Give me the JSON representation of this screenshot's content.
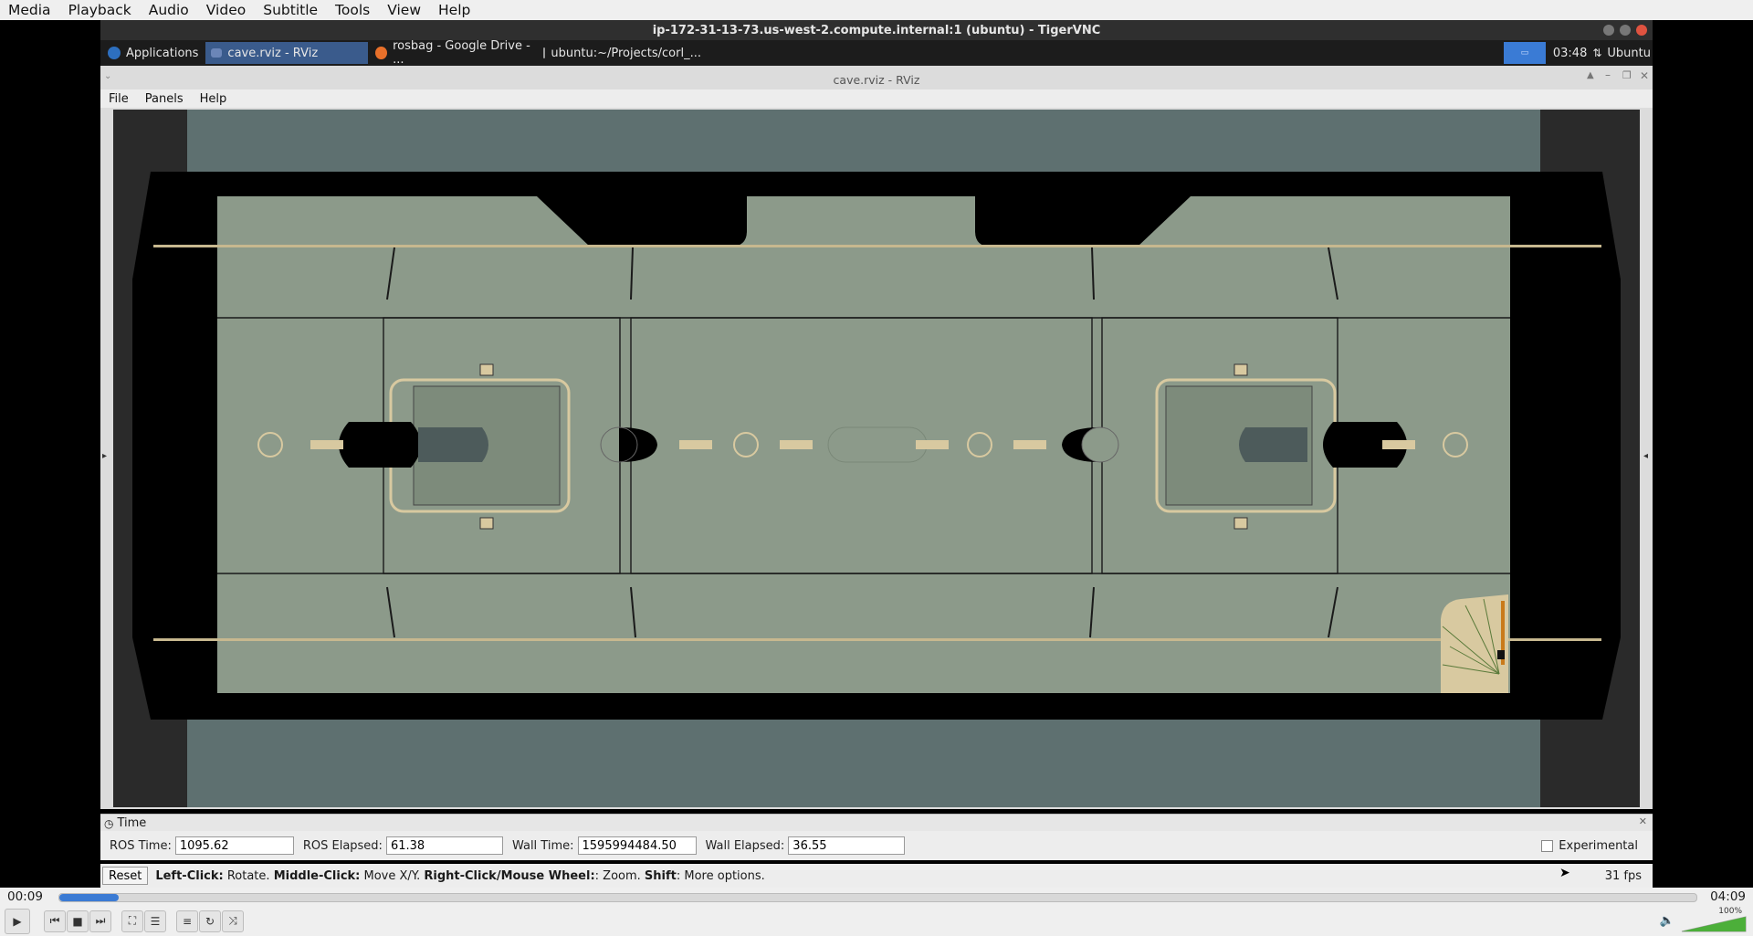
{
  "vlc": {
    "menu": [
      "Media",
      "Playback",
      "Audio",
      "Video",
      "Subtitle",
      "Tools",
      "View",
      "Help"
    ],
    "elapsed": "00:09",
    "total": "04:09",
    "progress": 0.036,
    "volume_label": "100%",
    "volume": 1.0
  },
  "vnc": {
    "title": "ip-172-31-13-73.us-west-2.compute.internal:1 (ubuntu) - TigerVNC"
  },
  "taskbar": {
    "applications": "Applications",
    "tasks": [
      {
        "label": "cave.rviz - RViz",
        "icon": "rviz-icon",
        "active": true
      },
      {
        "label": "rosbag - Google Drive - ...",
        "icon": "firefox-icon",
        "active": false
      },
      {
        "label": "ubuntu:~/Projects/corl_...",
        "icon": "terminal-icon",
        "active": false
      }
    ],
    "clock": "03:48",
    "user": "Ubuntu"
  },
  "rviz": {
    "title": "cave.rviz - RViz",
    "menu": [
      "File",
      "Panels",
      "Help"
    ],
    "time_panel": {
      "header": "Time",
      "ros_time_label": "ROS Time:",
      "ros_time": "1095.62",
      "ros_elapsed_label": "ROS Elapsed:",
      "ros_elapsed": "61.38",
      "wall_time_label": "Wall Time:",
      "wall_time": "1595994484.50",
      "wall_elapsed_label": "Wall Elapsed:",
      "wall_elapsed": "36.55",
      "experimental_label": "Experimental"
    },
    "status": {
      "reset": "Reset",
      "left_click": "Left-Click:",
      "left_click_text": "Rotate.",
      "middle_click": "Middle-Click:",
      "middle_click_text": "Move X/Y.",
      "right_click": "Right-Click/Mouse Wheel:",
      "right_click_text": ": Zoom.",
      "shift": "Shift",
      "shift_text": ": More options.",
      "fps": "31 fps"
    }
  },
  "colors": {
    "sky": "#5e7070",
    "floor": "#8c9a8a",
    "wall": "#000000",
    "sand": "#d8c9a0",
    "accent": "#3b7bd4"
  }
}
